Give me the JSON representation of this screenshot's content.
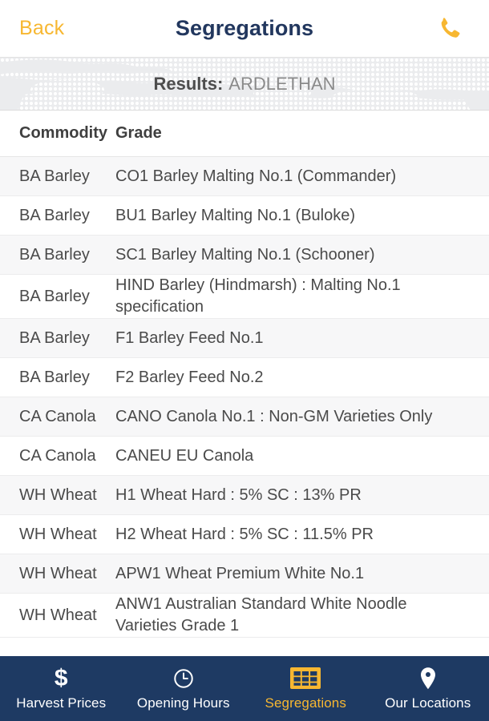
{
  "header": {
    "back_label": "Back",
    "title": "Segregations",
    "call_icon": "phone-icon"
  },
  "banner": {
    "results_label": "Results:",
    "location": "ARDLETHAN"
  },
  "table": {
    "columns": [
      "Commodity",
      "Grade"
    ],
    "rows": [
      {
        "commodity": "BA Barley",
        "grade": "CO1 Barley Malting No.1 (Commander)"
      },
      {
        "commodity": "BA Barley",
        "grade": "BU1 Barley Malting No.1 (Buloke)"
      },
      {
        "commodity": "BA Barley",
        "grade": "SC1 Barley Malting No.1 (Schooner)"
      },
      {
        "commodity": "BA Barley",
        "grade": "HIND Barley (Hindmarsh) : Malting No.1 specification"
      },
      {
        "commodity": "BA Barley",
        "grade": "F1 Barley Feed No.1"
      },
      {
        "commodity": "BA Barley",
        "grade": "F2 Barley Feed No.2"
      },
      {
        "commodity": "CA Canola",
        "grade": "CANO Canola No.1 : Non-GM Varieties Only"
      },
      {
        "commodity": "CA Canola",
        "grade": "CANEU EU Canola"
      },
      {
        "commodity": "WH Wheat",
        "grade": "H1 Wheat Hard : 5% SC : 13% PR"
      },
      {
        "commodity": "WH Wheat",
        "grade": "H2 Wheat Hard : 5% SC : 11.5% PR"
      },
      {
        "commodity": "WH Wheat",
        "grade": "APW1 Wheat Premium White No.1"
      },
      {
        "commodity": "WH Wheat",
        "grade": "ANW1 Australian Standard White Noodle Varieties Grade 1"
      }
    ]
  },
  "bottom_nav": {
    "items": [
      {
        "label": "Harvest Prices",
        "icon": "dollar-icon",
        "active": false
      },
      {
        "label": "Opening Hours",
        "icon": "clock-icon",
        "active": false
      },
      {
        "label": "Segregations",
        "icon": "table-grid-icon",
        "active": true
      },
      {
        "label": "Our Locations",
        "icon": "map-pin-icon",
        "active": false
      }
    ]
  },
  "colors": {
    "accent_yellow": "#f7b731",
    "navy": "#1e3a63",
    "row_alt": "#f7f7f8",
    "banner_bg": "#ebecee"
  }
}
